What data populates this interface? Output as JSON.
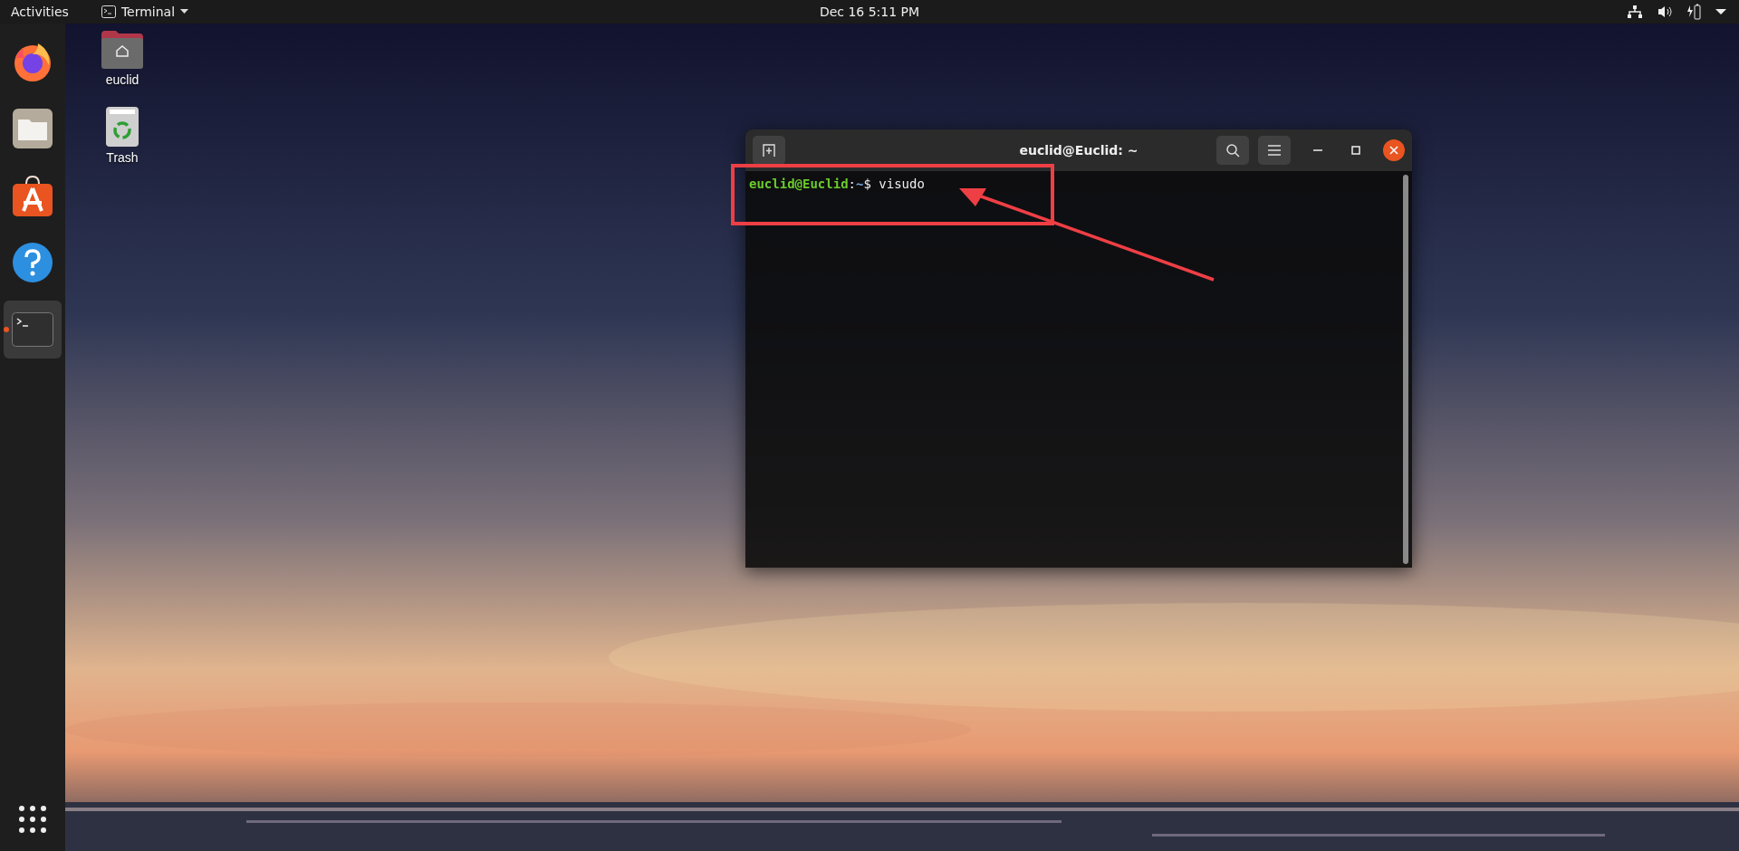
{
  "top_bar": {
    "activities": "Activities",
    "app_menu": "Terminal",
    "clock": "Dec 16  5:11 PM"
  },
  "dock": {
    "items": [
      {
        "kind": "browser",
        "selected": false,
        "running": false
      },
      {
        "kind": "files",
        "selected": false,
        "running": false
      },
      {
        "kind": "software",
        "selected": false,
        "running": false
      },
      {
        "kind": "help",
        "selected": false,
        "running": false
      },
      {
        "kind": "terminal",
        "selected": true,
        "running": true
      }
    ]
  },
  "desktop_icons": [
    {
      "kind": "home",
      "label": "euclid"
    },
    {
      "kind": "trash",
      "label": "Trash"
    }
  ],
  "terminal": {
    "title": "euclid@Euclid: ~",
    "line": {
      "user": "euclid@Euclid",
      "separator": ":",
      "path": "~",
      "symbol": "$",
      "command": "visudo"
    }
  }
}
